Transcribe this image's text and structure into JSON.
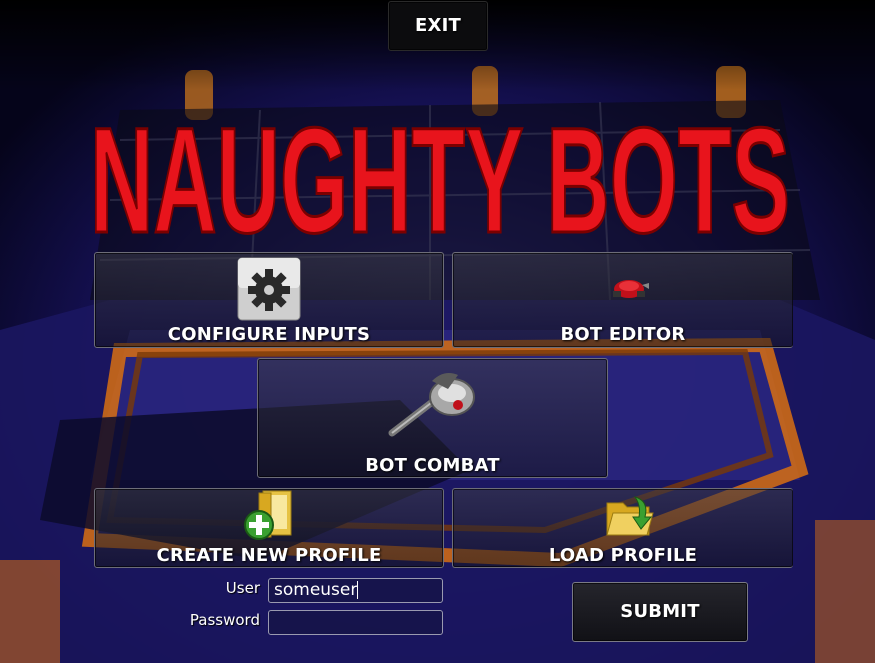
{
  "title": "NAUGHTY BOTS",
  "exit_label": "EXIT",
  "menu": {
    "configure_inputs": {
      "label": "CONFIGURE INPUTS",
      "icon": "gear-icon"
    },
    "bot_editor": {
      "label": "BOT EDITOR",
      "icon": "robot-icon"
    },
    "bot_combat": {
      "label": "BOT COMBAT",
      "icon": "battle-axe-icon"
    },
    "create_profile": {
      "label": "CREATE NEW PROFILE",
      "icon": "new-folder-icon"
    },
    "load_profile": {
      "label": "LOAD PROFILE",
      "icon": "open-folder-icon"
    }
  },
  "login": {
    "user_label": "User",
    "user_value": "someuser",
    "password_label": "Password",
    "password_value": "",
    "submit_label": "SUBMIT"
  },
  "colors": {
    "title_red": "#e8141c",
    "arena_blue": "#1c1870",
    "arena_orange": "#d46a10"
  }
}
